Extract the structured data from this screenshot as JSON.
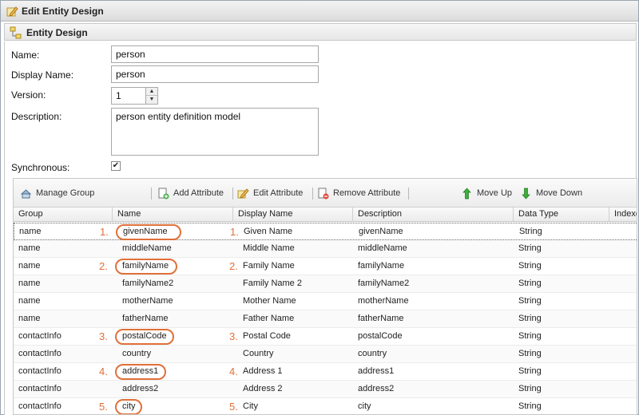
{
  "window": {
    "title": "Edit Entity Design"
  },
  "panel": {
    "title": "Entity Design"
  },
  "form": {
    "name_label": "Name:",
    "name_value": "person",
    "display_name_label": "Display Name:",
    "display_name_value": "person",
    "version_label": "Version:",
    "version_value": "1",
    "description_label": "Description:",
    "description_value": "person entity definition model",
    "synchronous_label": "Synchronous:",
    "synchronous_checked": true
  },
  "toolbar": {
    "manage_group": "Manage Group",
    "add_attribute": "Add Attribute",
    "edit_attribute": "Edit Attribute",
    "remove_attribute": "Remove Attribute",
    "move_up": "Move Up",
    "move_down": "Move Down"
  },
  "columns": [
    "Group",
    "Name",
    "Display Name",
    "Description",
    "Data Type",
    "Indexe"
  ],
  "rows": [
    {
      "group": "name",
      "name": "givenName",
      "display": "Given Name",
      "description": "givenName",
      "type": "String",
      "anno": "1."
    },
    {
      "group": "name",
      "name": "middleName",
      "display": "Middle Name",
      "description": "middleName",
      "type": "String",
      "anno": ""
    },
    {
      "group": "name",
      "name": "familyName",
      "display": "Family Name",
      "description": "familyName",
      "type": "String",
      "anno": "2."
    },
    {
      "group": "name",
      "name": "familyName2",
      "display": "Family Name 2",
      "description": "familyName2",
      "type": "String",
      "anno": ""
    },
    {
      "group": "name",
      "name": "motherName",
      "display": "Mother Name",
      "description": "motherName",
      "type": "String",
      "anno": ""
    },
    {
      "group": "name",
      "name": "fatherName",
      "display": "Father Name",
      "description": "fatherName",
      "type": "String",
      "anno": ""
    },
    {
      "group": "contactInfo",
      "name": "postalCode",
      "display": "Postal Code",
      "description": "postalCode",
      "type": "String",
      "anno": "3."
    },
    {
      "group": "contactInfo",
      "name": "country",
      "display": "Country",
      "description": "country",
      "type": "String",
      "anno": ""
    },
    {
      "group": "contactInfo",
      "name": "address1",
      "display": "Address 1",
      "description": "address1",
      "type": "String",
      "anno": "4."
    },
    {
      "group": "contactInfo",
      "name": "address2",
      "display": "Address 2",
      "description": "address2",
      "type": "String",
      "anno": ""
    },
    {
      "group": "contactInfo",
      "name": "city",
      "display": "City",
      "description": "city",
      "type": "String",
      "anno": "5."
    }
  ],
  "colors": {
    "annotation": "#e0703a"
  }
}
